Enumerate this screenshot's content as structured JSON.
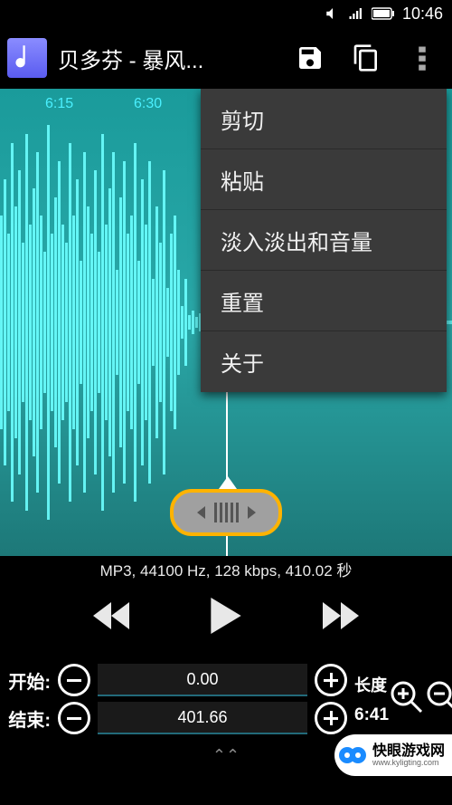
{
  "status": {
    "time": "10:46"
  },
  "header": {
    "title": "贝多芬 - 暴风..."
  },
  "timeline": {
    "t1": "6:15",
    "t2": "6:30"
  },
  "info": {
    "text": "MP3, 44100 Hz, 128 kbps, 410.02 秒"
  },
  "range": {
    "startLabel": "开始:",
    "startValue": "0.00",
    "endLabel": "结束:",
    "endValue": "401.66",
    "lengthLabel": "长度",
    "lengthValue": "6:41"
  },
  "menu": {
    "cut": "剪切",
    "paste": "粘贴",
    "fade": "淡入淡出和音量",
    "reset": "重置",
    "about": "关于"
  },
  "watermark": {
    "cn": "快眼游戏网",
    "en": "www.kyligting.com"
  }
}
